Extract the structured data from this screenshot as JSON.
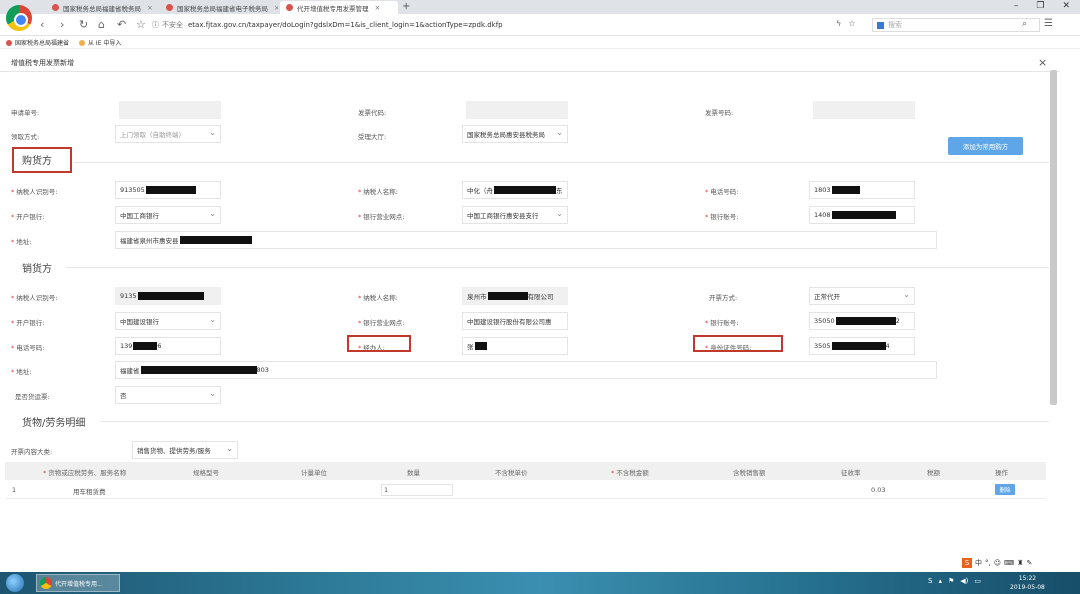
{
  "browser": {
    "tabs": [
      {
        "label": "国家税务总局福建省税务局"
      },
      {
        "label": "国家税务总局福建省电子税务局"
      },
      {
        "label": "代开增值税专用发票管理"
      }
    ],
    "url_warning": "不安全",
    "url": "etax.fjtax.gov.cn/taxpayer/doLogin?gdslxDm=1&is_client_login=1&actionType=zpdk.dkfp",
    "search_placeholder": "搜索",
    "bookmarks": [
      "国家税务总局福建省",
      "从 IE 中导入"
    ]
  },
  "page": {
    "title": "增值税专用发票新增",
    "close": "×"
  },
  "top_fields": {
    "apply_no_label": "申请单号:",
    "invoice_code_label": "发票代码:",
    "invoice_no_label": "发票号码:",
    "receive_label": "领取方式:",
    "receive_value": "上门领取（自助终端）",
    "hall_label": "受理大厅:",
    "hall_value": "国家税务总局惠安县税务局",
    "add_button": "添加为常用购方"
  },
  "buyer": {
    "section": "购货方",
    "taxid_label": "纳税人识别号:",
    "taxid_value": "913505",
    "name_label": "纳税人名称:",
    "name_value": "中化（舟",
    "name_tail": "东",
    "phone_label": "电话号码:",
    "phone_value": "1803",
    "bank_label": "开户银行:",
    "bank_value": "中国工商银行",
    "branch_label": "银行营业网点:",
    "branch_value": "中国工商银行惠安县支行",
    "account_label": "银行账号:",
    "account_value": "1408",
    "address_label": "地址:",
    "address_value": "福建省泉州市惠安县"
  },
  "seller": {
    "section": "销货方",
    "taxid_label": "纳税人识别号:",
    "taxid_value": "9135",
    "name_label": "纳税人名称:",
    "name_value": "泉州市",
    "name_tail": "有限公司",
    "mode_label": "开票方式:",
    "mode_value": "正常代开",
    "bank_label": "开户银行:",
    "bank_value": "中国建设银行",
    "branch_label": "银行营业网点:",
    "branch_value": "中国建设银行股份有限公司惠",
    "account_label": "银行账号:",
    "account_value": "35050",
    "account_tail": "2",
    "phone_label": "电话号码:",
    "phone_value": "139",
    "phone_tail": "6",
    "handler_label": "经办人:",
    "handler_value": "张",
    "idno_label": "身份证件号码:",
    "idno_value": "3505",
    "idno_tail": "4",
    "address_label": "地址:",
    "address_value": "福建省",
    "address_tail": "803",
    "vehicle_label": "是否货运票:",
    "vehicle_value": "否"
  },
  "goods": {
    "section": "货物/劳务明细",
    "category_label": "开票内容大类:",
    "category_value": "销售货物、提供劳务/服务",
    "columns": [
      "货物或应税劳务、服务名称",
      "规格型号",
      "计量单位",
      "数量",
      "不含税单价",
      "不含税金额",
      "含税销售额",
      "征收率",
      "税额",
      "操作"
    ],
    "rows": [
      {
        "index": "1",
        "name": "用车租赁费",
        "quantity": "1",
        "rate": "0.03",
        "action": "删除"
      }
    ]
  },
  "taskbar": {
    "app_label": "代开增值税专用...",
    "ime_text": "中",
    "time": "15:22",
    "date": "2019-05-08"
  },
  "colors": {
    "required_star": "#e4393c",
    "highlight_box": "#c0392b",
    "primary_button": "#5fa6e8"
  }
}
